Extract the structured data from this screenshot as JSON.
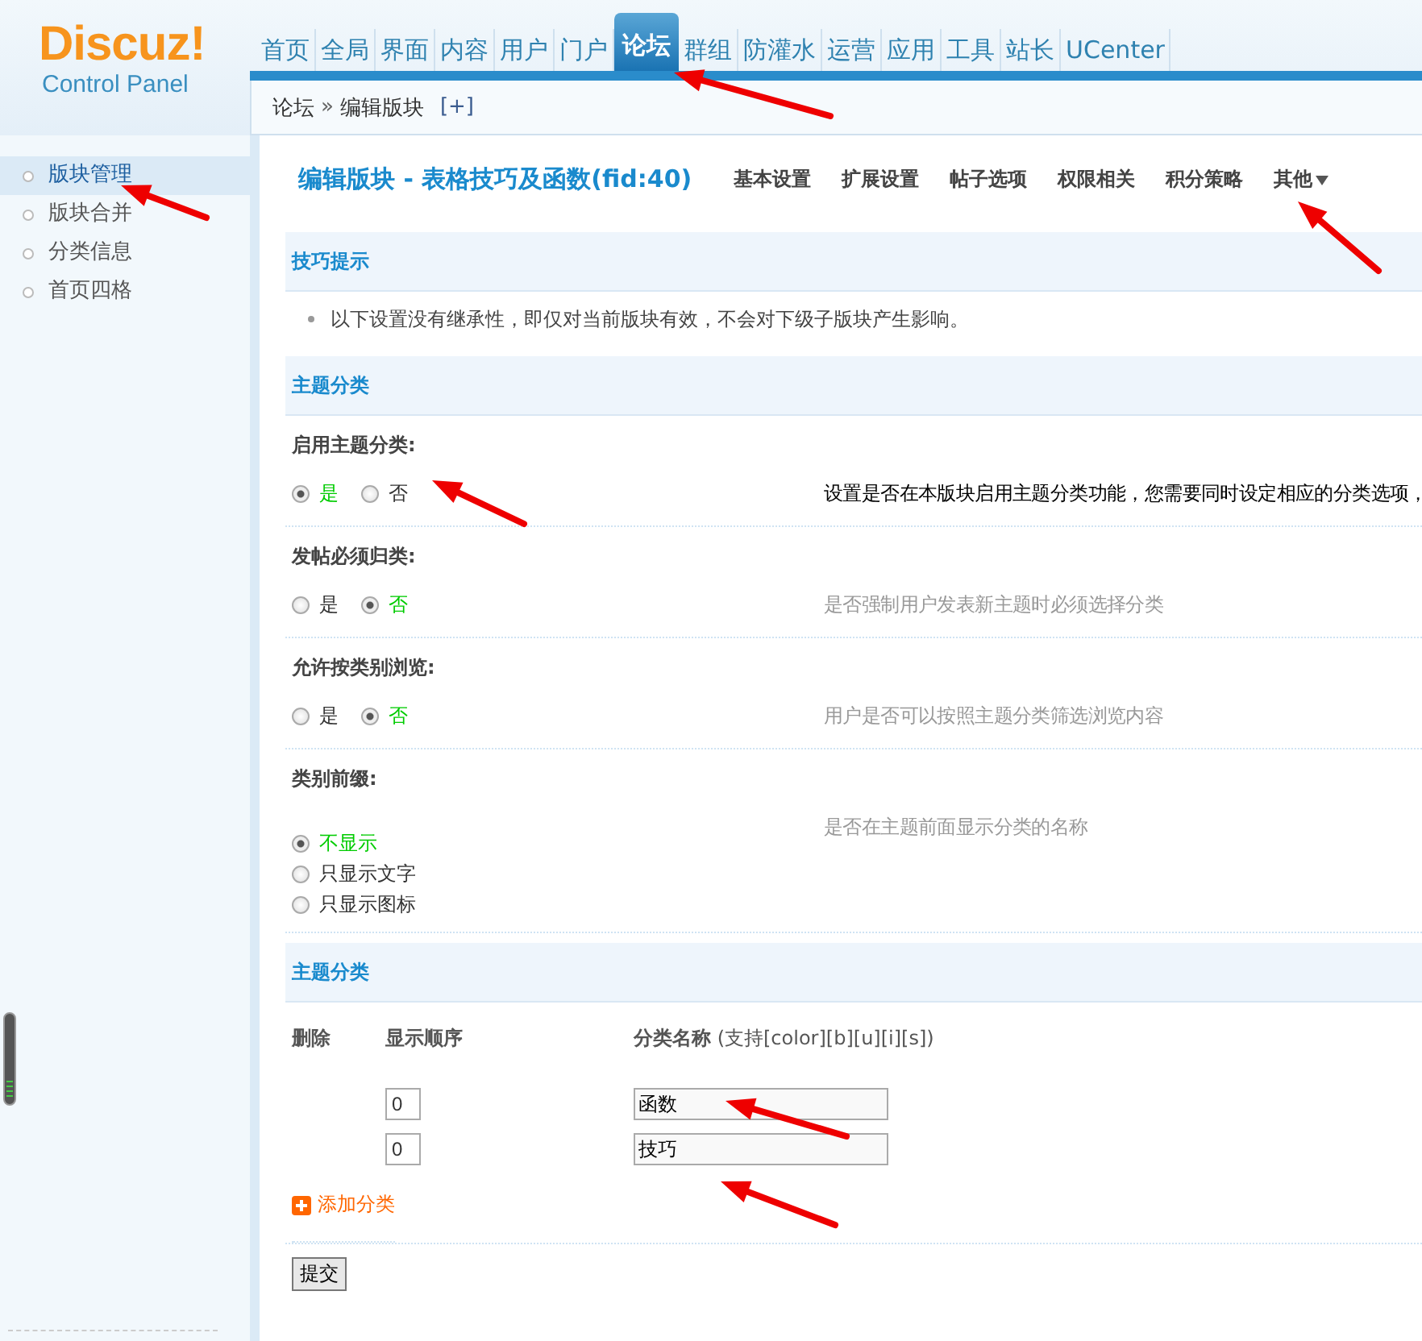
{
  "logo": {
    "name": "Discuz!",
    "subtitle": "Control Panel"
  },
  "nav": [
    {
      "label": "首页",
      "selected": false
    },
    {
      "label": "全局",
      "selected": false
    },
    {
      "label": "界面",
      "selected": false
    },
    {
      "label": "内容",
      "selected": false
    },
    {
      "label": "用户",
      "selected": false
    },
    {
      "label": "门户",
      "selected": false
    },
    {
      "label": "论坛",
      "selected": true
    },
    {
      "label": "群组",
      "selected": false
    },
    {
      "label": "防灌水",
      "selected": false
    },
    {
      "label": "运营",
      "selected": false
    },
    {
      "label": "应用",
      "selected": false
    },
    {
      "label": "工具",
      "selected": false
    },
    {
      "label": "站长",
      "selected": false
    },
    {
      "label": "UCenter",
      "selected": false
    }
  ],
  "breadcrumb": {
    "items": [
      "论坛",
      "编辑版块"
    ],
    "separator": "»",
    "add": "[+]"
  },
  "sidebar": [
    {
      "label": "版块管理",
      "selected": true
    },
    {
      "label": "版块合并",
      "selected": false
    },
    {
      "label": "分类信息",
      "selected": false
    },
    {
      "label": "首页四格",
      "selected": false
    }
  ],
  "page": {
    "title": "编辑版块 - 表格技巧及函数(fid:40)",
    "tabs": [
      "基本设置",
      "扩展设置",
      "帖子选项",
      "权限相关",
      "积分策略"
    ],
    "more": "其他"
  },
  "tips": {
    "title": "技巧提示",
    "items": [
      "以下设置没有继承性，即仅对当前版块有效，不会对下级子版块产生影响。"
    ]
  },
  "settings": {
    "title": "主题分类",
    "rows": [
      {
        "label": "启用主题分类:",
        "kind": "row",
        "highlighted": true,
        "description": "设置是否在本版块启用主题分类功能，您需要同时设定相应的分类选项，",
        "options": [
          {
            "label": "是",
            "selected": true
          },
          {
            "label": "否",
            "selected": false
          }
        ]
      },
      {
        "label": "发帖必须归类:",
        "kind": "row",
        "highlighted": false,
        "description": "是否强制用户发表新主题时必须选择分类",
        "options": [
          {
            "label": "是",
            "selected": false
          },
          {
            "label": "否",
            "selected": true
          }
        ]
      },
      {
        "label": "允许按类别浏览:",
        "kind": "row",
        "highlighted": false,
        "description": "用户是否可以按照主题分类筛选浏览内容",
        "options": [
          {
            "label": "是",
            "selected": false
          },
          {
            "label": "否",
            "selected": true
          }
        ]
      },
      {
        "label": "类别前缀:",
        "kind": "list",
        "highlighted": false,
        "description": "是否在主题前面显示分类的名称",
        "options": [
          {
            "label": "不显示",
            "selected": true
          },
          {
            "label": "只显示文字",
            "selected": false
          },
          {
            "label": "只显示图标",
            "selected": false
          }
        ]
      }
    ]
  },
  "categories": {
    "title": "主题分类",
    "columns": [
      "删除",
      "显示顺序",
      "**分类名称** (支持[color][b][u][i][s])"
    ],
    "rows": [
      {
        "order": "0",
        "name": "函数"
      },
      {
        "order": "0",
        "name": "技巧"
      }
    ],
    "add": "添加分类"
  },
  "submit": "提交"
}
